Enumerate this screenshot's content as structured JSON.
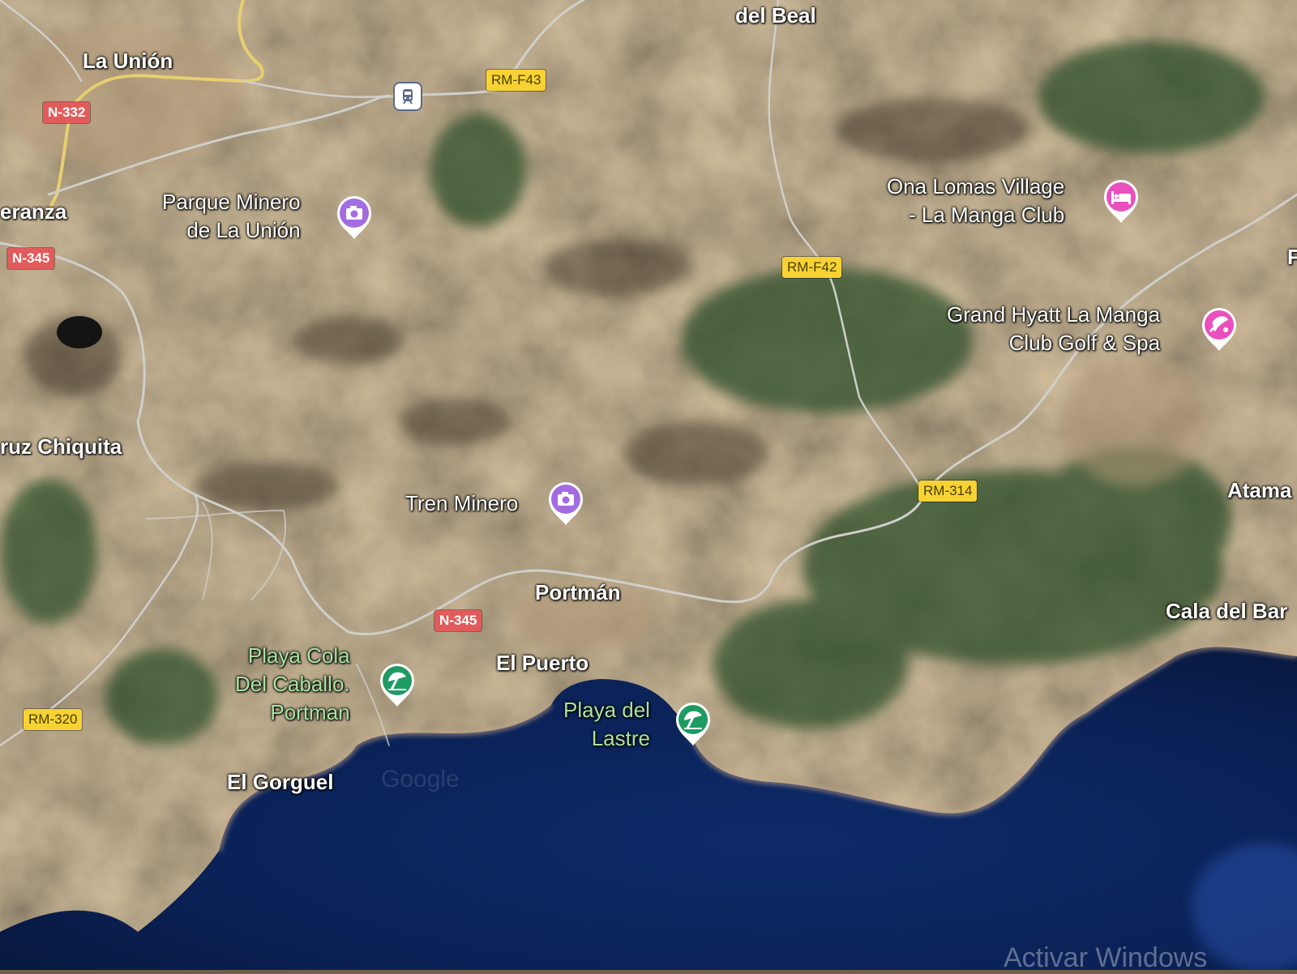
{
  "colors": {
    "sea": "#0b2358",
    "land": "#8a7656",
    "vegetation": "#2f5029",
    "road": "#d6d6d0",
    "highway_yellow": "#f7d233",
    "national_red": "#e25b5b",
    "poi_purple": "#a46ce0",
    "poi_pink": "#e94fbd",
    "poi_green": "#1e9b62",
    "beach_label": "#a8e4a2"
  },
  "places": {
    "del_beal": "del Beal",
    "la_union": "La Unión",
    "eranza": "eranza",
    "cruz_chiquita": "ruz Chiquita",
    "portman": "Portmán",
    "el_puerto": "El Puerto",
    "el_gorguel": "El Gorguel",
    "atama": "Atama",
    "cala_del_bar": "Cala del Bar"
  },
  "roads": {
    "n332": "N-332",
    "n345_west": "N-345",
    "n345_south": "N-345",
    "rm_f43": "RM-F43",
    "rm_f42": "RM-F42",
    "rm_314": "RM-314",
    "rm_320": "RM-320"
  },
  "pois": {
    "parque_minero": {
      "line1": "Parque Minero",
      "line2": "de La Unión",
      "icon": "camera-icon"
    },
    "tren_minero": {
      "line1": "Tren Minero",
      "icon": "camera-icon"
    },
    "ona_lomas": {
      "line1": "Ona Lomas Village",
      "line2": "- La Manga Club",
      "icon": "hotel-bed-icon"
    },
    "grand_hyatt": {
      "line1": "Grand Hyatt La Manga",
      "line2": "Club Golf & Spa",
      "icon": "spa-icon"
    },
    "playa_cola": {
      "line1": "Playa Cola",
      "line2": "Del Caballo.",
      "line3": "Portman",
      "icon": "beach-umbrella-icon"
    },
    "playa_lastre": {
      "line1": "Playa del",
      "line2": "Lastre",
      "icon": "beach-umbrella-icon"
    }
  },
  "transit": {
    "icon": "train-station-icon"
  },
  "watermark": "Activar Windows",
  "google_mark": "Google",
  "edge_letter": "F"
}
